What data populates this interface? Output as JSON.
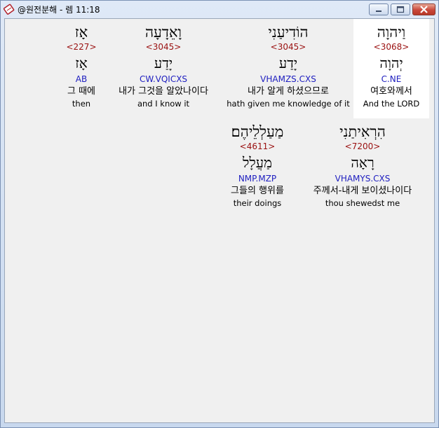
{
  "window": {
    "title": "@원전분해 - 렘 11:18"
  },
  "icons": {
    "app": "bible-book-icon",
    "minimize": "minimize-icon",
    "maximize": "maximize-icon",
    "close": "close-icon"
  },
  "rows": [
    {
      "words": [
        {
          "hebrew": "אָז",
          "strong": "<227>",
          "lemma": "אָז",
          "parse": "AB",
          "korean": "그 때에",
          "english": "then"
        },
        {
          "hebrew": "וָאֵדָעָה",
          "strong": "<3045>",
          "lemma": "יָדַע",
          "parse": "CW.VQICXS",
          "korean": "내가 그것을 알았나이다",
          "english": "and I know it"
        },
        {
          "hebrew": "הוֹדִיעַנִי",
          "strong": "<3045>",
          "lemma": "יָדַע",
          "parse": "VHAMZS.CXS",
          "korean": "내가 알게 하셨으므로",
          "english": "hath given me knowledge of it"
        },
        {
          "hebrew": "וַיהוָה",
          "strong": "<3068>",
          "lemma": "יְהוָה",
          "parse": "C.NE",
          "korean": "여호와께서",
          "english": "And the LORD"
        }
      ]
    },
    {
      "words": [
        {
          "hebrew": "מַעַלְלֵיהֶם׃",
          "strong": "<4611>",
          "lemma": "מַעֲלָל",
          "parse": "NMP.MZP",
          "korean": "그들의 행위를",
          "english": "their doings"
        },
        {
          "hebrew": "הִרְאִיתַנִי",
          "strong": "<7200>",
          "lemma": "רָאָה",
          "parse": "VHAMYS.CXS",
          "korean": "주께서-내게 보이셨나이다",
          "english": "thou shewedst me"
        }
      ]
    }
  ]
}
